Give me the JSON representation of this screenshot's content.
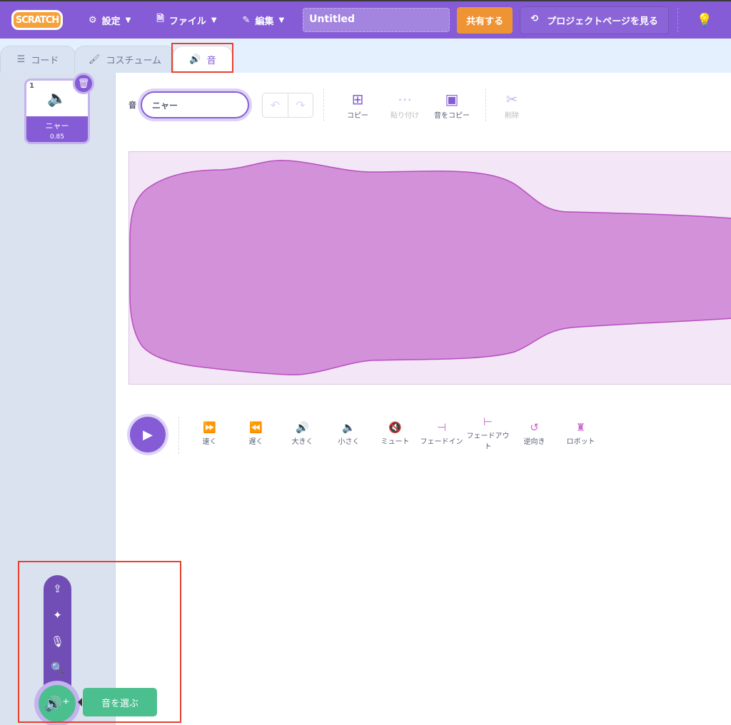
{
  "menubar": {
    "logo": "SCRATCH",
    "settings": "設定",
    "file": "ファイル",
    "edit": "編集",
    "project_title": "Untitled",
    "share": "共有する",
    "see_project_page": "プロジェクトページを見る"
  },
  "tabs": [
    {
      "label": "コード"
    },
    {
      "label": "コスチューム"
    },
    {
      "label": "音",
      "active": true
    }
  ],
  "sounds": [
    {
      "index": "1",
      "name": "ニャー",
      "duration": "0.85"
    }
  ],
  "editor": {
    "name_label": "音",
    "name_value": "ニャー",
    "copy": "コピー",
    "paste": "貼り付け",
    "copy_to_new": "音をコピー",
    "delete": "削除"
  },
  "effects": [
    "速く",
    "遅く",
    "大きく",
    "小さく",
    "ミュート",
    "フェードイン",
    "フェードアウト",
    "逆向き",
    "ロボット"
  ],
  "add_sound": {
    "tooltip": "音を選ぶ",
    "menu": [
      "upload-icon",
      "surprise-icon",
      "record-icon",
      "search-icon"
    ]
  },
  "colors": {
    "accent": "#855cd6",
    "share": "#ef9435",
    "add": "#4cbf8f",
    "wave_fill": "#d291d8",
    "wave_stroke": "#b84fc0",
    "highlight": "#e8402b"
  }
}
